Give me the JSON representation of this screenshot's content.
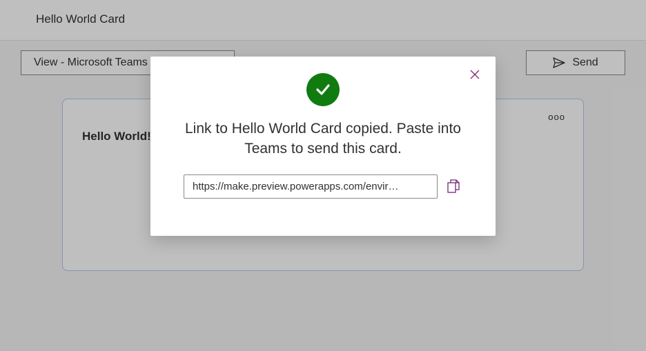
{
  "header": {
    "title": "Hello World Card"
  },
  "toolbar": {
    "view_label": "View - Microsoft Teams -",
    "send_label": "Send"
  },
  "card": {
    "content": "Hello World!"
  },
  "modal": {
    "message": "Link to Hello World Card copied. Paste into Teams to send this card.",
    "url": "https://make.preview.powerapps.com/envir…"
  }
}
